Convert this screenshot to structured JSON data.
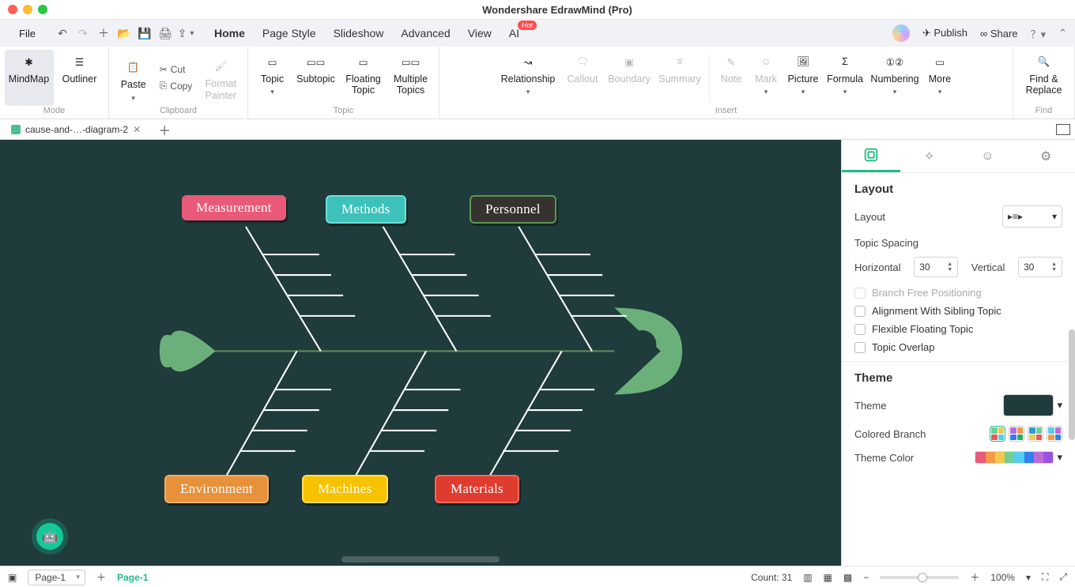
{
  "window": {
    "title": "Wondershare EdrawMind (Pro)"
  },
  "menu": {
    "file": "File",
    "tabs": [
      "Home",
      "Page Style",
      "Slideshow",
      "Advanced",
      "View",
      "AI"
    ],
    "active_tab": "Home",
    "hot_badge": "Hot",
    "publish": "Publish",
    "share": "Share"
  },
  "toolbar": {
    "mode": {
      "mindmap": "MindMap",
      "outliner": "Outliner",
      "group": "Mode"
    },
    "clipboard": {
      "paste": "Paste",
      "cut": "Cut",
      "copy": "Copy",
      "format_painter": "Format\nPainter",
      "group": "Clipboard"
    },
    "topic": {
      "topic": "Topic",
      "subtopic": "Subtopic",
      "floating": "Floating\nTopic",
      "multiple": "Multiple\nTopics",
      "group": "Topic"
    },
    "insert": {
      "relationship": "Relationship",
      "callout": "Callout",
      "boundary": "Boundary",
      "summary": "Summary",
      "note": "Note",
      "mark": "Mark",
      "picture": "Picture",
      "formula": "Formula",
      "numbering": "Numbering",
      "more": "More",
      "group": "Insert"
    },
    "find": {
      "label": "Find &\nReplace",
      "group": "Find"
    }
  },
  "doctab": {
    "name": "cause-and-…-diagram-2"
  },
  "fishbone": {
    "top": [
      "Measurement",
      "Methods",
      "Personnel"
    ],
    "bottom": [
      "Environment",
      "Machines",
      "Materials"
    ]
  },
  "panel": {
    "layout_heading": "Layout",
    "layout_label": "Layout",
    "topic_spacing": "Topic Spacing",
    "horizontal": "Horizontal",
    "h_val": "30",
    "vertical": "Vertical",
    "v_val": "30",
    "branch_free": "Branch Free Positioning",
    "align_sibling": "Alignment With Sibling Topic",
    "flexible_floating": "Flexible Floating Topic",
    "topic_overlap": "Topic Overlap",
    "theme_heading": "Theme",
    "theme_label": "Theme",
    "colored_branch": "Colored Branch",
    "theme_color": "Theme Color"
  },
  "status": {
    "page_select": "Page-1",
    "page_active": "Page-1",
    "count": "Count: 31",
    "zoom": "100%"
  }
}
